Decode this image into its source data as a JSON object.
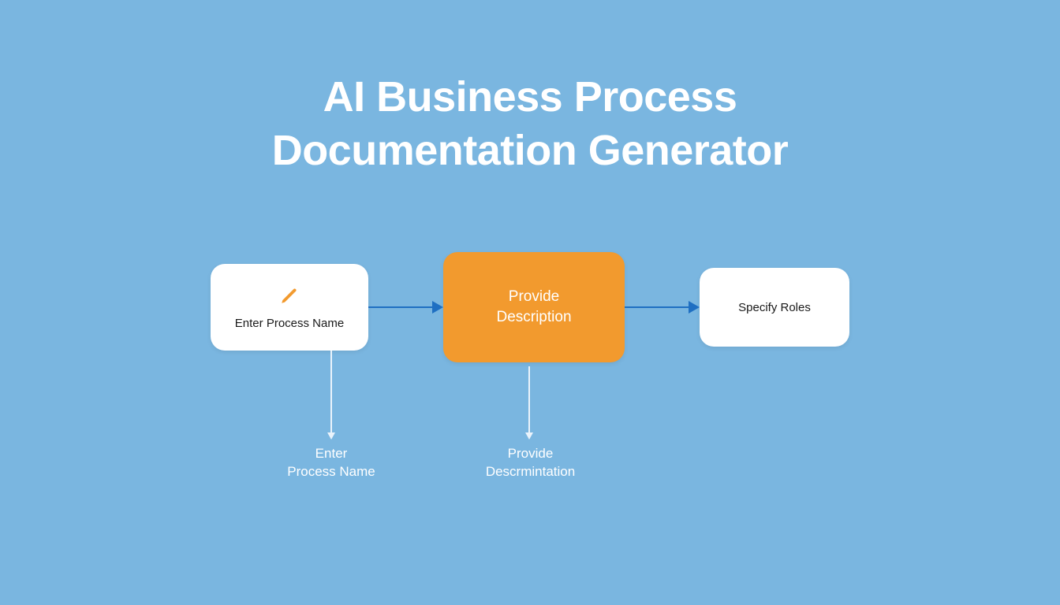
{
  "title_line1": "AI Business Process",
  "title_line2": "Documentation Generator",
  "steps": {
    "one": {
      "label": "Enter Process Name"
    },
    "two": {
      "label_line1": "Provide",
      "label_line2": "Description"
    },
    "three": {
      "label": "Specify Roles"
    }
  },
  "sublabels": {
    "one_line1": "Enter",
    "one_line2": "Process Name",
    "two_line1": "Provide",
    "two_line2": "Descrmintation"
  },
  "colors": {
    "background": "#7ab6e0",
    "accent": "#f29a2e",
    "arrow": "#1f6fc2",
    "text_light": "#ffffff"
  }
}
